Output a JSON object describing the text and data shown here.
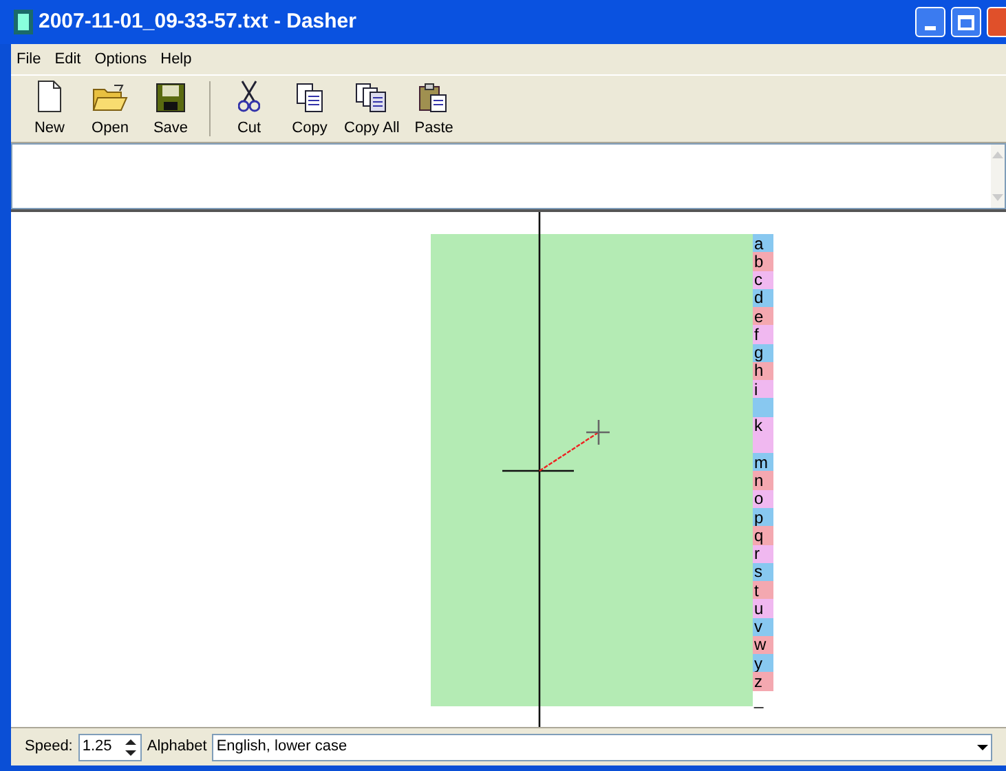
{
  "window": {
    "title": "2007-11-01_09-33-57.txt - Dasher"
  },
  "menu": [
    "File",
    "Edit",
    "Options",
    "Help"
  ],
  "toolbar": [
    {
      "kind": "new",
      "label": "New"
    },
    {
      "kind": "open",
      "label": "Open"
    },
    {
      "kind": "save",
      "label": "Save"
    },
    {
      "kind": "separator"
    },
    {
      "kind": "cut",
      "label": "Cut"
    },
    {
      "kind": "copy",
      "label": "Copy"
    },
    {
      "kind": "copyall",
      "label": "Copy All"
    },
    {
      "kind": "paste",
      "label": "Paste"
    }
  ],
  "letters": [
    {
      "letter": "a",
      "color": "#88c8f0"
    },
    {
      "letter": "b",
      "color": "#f4a8b0"
    },
    {
      "letter": "c",
      "color": "#f0b8f0"
    },
    {
      "letter": "d",
      "color": "#88c8f0"
    },
    {
      "letter": "e",
      "color": "#f4a8b0"
    },
    {
      "letter": "f",
      "color": "#f0b8f0"
    },
    {
      "letter": "g",
      "color": "#88c8f0"
    },
    {
      "letter": "h",
      "color": "#f4a8b0"
    },
    {
      "letter": "i",
      "color": "#f0b8f0"
    },
    {
      "color": "#88c8f0"
    },
    {
      "letter": "k",
      "color": "#f0b8f0"
    },
    {
      "color": "#f0b8f0"
    },
    {
      "letter": "m",
      "color": "#88c8f0"
    },
    {
      "letter": "n",
      "color": "#f4a8b0"
    },
    {
      "letter": "o",
      "color": "#f0b8f0"
    },
    {
      "letter": "p",
      "color": "#88c8f0"
    },
    {
      "letter": "q",
      "color": "#f4a8b0"
    },
    {
      "letter": "r",
      "color": "#f0b8f0"
    },
    {
      "letter": "s",
      "color": "#88c8f0"
    },
    {
      "letter": "t",
      "color": "#f4a8b0"
    },
    {
      "letter": "u",
      "color": "#f0b8f0"
    },
    {
      "letter": "v",
      "color": "#88c8f0"
    },
    {
      "letter": "w",
      "color": "#f4a8b0"
    },
    {
      "letter": "y",
      "color": "#88c8f0"
    },
    {
      "letter": "z",
      "color": "#f4a8b0"
    },
    {
      "letter": "_",
      "color": "#ffffff"
    }
  ],
  "status": {
    "speed_label": "Speed:",
    "speed": "1.25",
    "alphabet_label": "Alphabet",
    "alphabet": "English, lower case"
  }
}
